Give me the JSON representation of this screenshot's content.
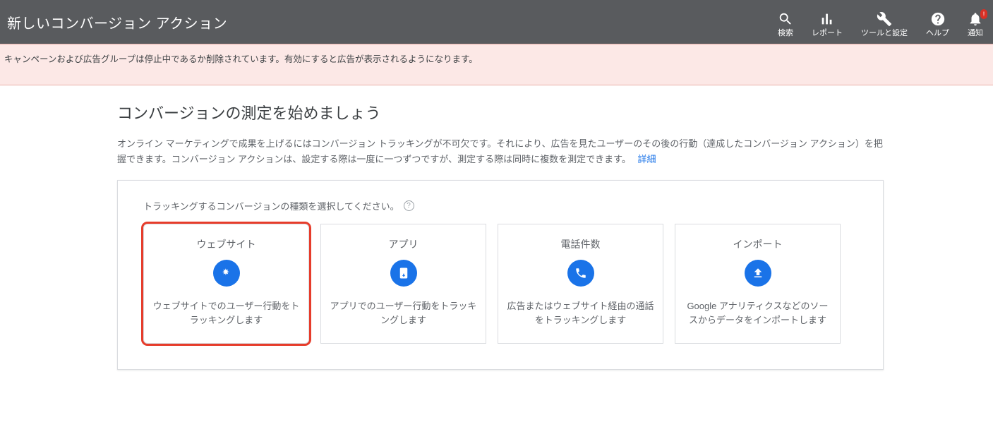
{
  "header": {
    "title": "新しいコンバージョン アクション",
    "nav": {
      "search": "検索",
      "reports": "レポート",
      "tools": "ツールと設定",
      "help": "ヘルプ",
      "notifications": "通知"
    }
  },
  "warning": "キャンペーンおよび広告グループは停止中であるか削除されています。有効にすると広告が表示されるようになります。",
  "page": {
    "heading": "コンバージョンの測定を始めましょう",
    "description": "オンライン マーケティングで成果を上げるにはコンバージョン トラッキングが不可欠です。それにより、広告を見たユーザーのその後の行動（達成したコンバージョン アクション）を把握できます。コンバージョン アクションは、設定する際は一度に一つずつですが、測定する際は同時に複数を測定できます。",
    "learn_more": "詳細",
    "select_prompt": "トラッキングするコンバージョンの種類を選択してください。"
  },
  "cards": {
    "website": {
      "title": "ウェブサイト",
      "desc": "ウェブサイトでのユーザー行動をトラッキングします"
    },
    "app": {
      "title": "アプリ",
      "desc": "アプリでのユーザー行動をトラッキングします"
    },
    "phone": {
      "title": "電話件数",
      "desc": "広告またはウェブサイト経由の通話をトラッキングします"
    },
    "import": {
      "title": "インポート",
      "desc": "Google アナリティクスなどのソースからデータをインポートします"
    }
  }
}
